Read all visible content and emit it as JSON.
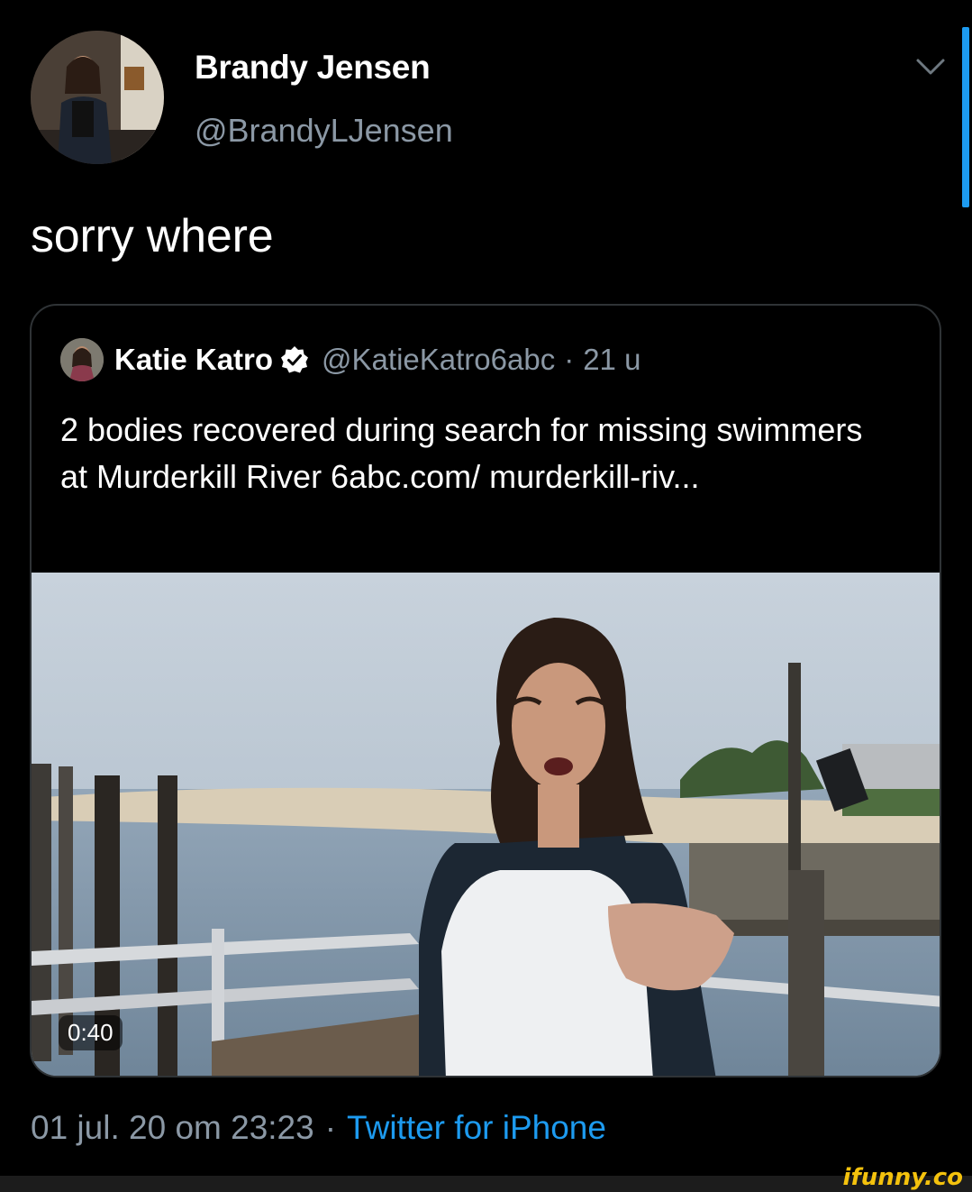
{
  "tweet": {
    "author_name": "Brandy Jensen",
    "author_handle": "@BrandyLJensen",
    "text": "sorry where",
    "date": "01 jul. 20 om 23:23",
    "separator": "·",
    "source": "Twitter for iPhone"
  },
  "quoted_tweet": {
    "author_name": "Katie Katro",
    "author_handle": "@KatieKatro6abc",
    "separator": "·",
    "time": "21 u",
    "text": "2 bodies recovered during search for missing swimmers at Murderkill River 6abc.com/ murderkill-riv...",
    "video_duration": "0:40"
  },
  "watermark": "ifunny.co",
  "colors": {
    "background": "#000000",
    "secondary_text": "#8b98a5",
    "link": "#1d9bf0",
    "border": "#2f3336",
    "watermark": "#f4c20d"
  },
  "icons": [
    "chevron-down-icon",
    "verified-badge-icon"
  ]
}
